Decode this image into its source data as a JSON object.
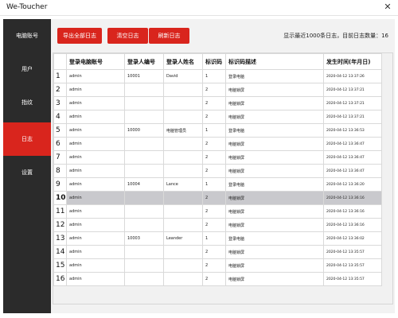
{
  "app": {
    "title": "We-Toucher",
    "close_symbol": "✕"
  },
  "sidebar": {
    "items": [
      {
        "label": "电脑账号",
        "active": false
      },
      {
        "label": "用户",
        "active": false
      },
      {
        "label": "指纹",
        "active": false
      },
      {
        "label": "日志",
        "active": true
      },
      {
        "label": "设置",
        "active": false
      }
    ]
  },
  "toolbar": {
    "export_label": "导出全部日志",
    "clear_label": "清空日志",
    "refresh_label": "刷新日志",
    "status_text": "显示最近1000条日志，目前日志数量：16"
  },
  "colors": {
    "accent": "#d9251d",
    "sidebar_bg": "#2b2b2b",
    "selected_row": "#c9c9cd"
  },
  "table": {
    "columns": [
      "登录电脑账号",
      "登录人编号",
      "登录人姓名",
      "标识码",
      "标识码描述",
      "发生时间(年月日)"
    ],
    "selected_row": 10,
    "rows": [
      {
        "index": "1",
        "account": "admin",
        "user_id": "10001",
        "user_name": "David",
        "code": "1",
        "desc": "登录电脑",
        "time": "2020-04-12 13:37:26"
      },
      {
        "index": "2",
        "account": "admin",
        "user_id": "",
        "user_name": "",
        "code": "2",
        "desc": "电脑锁屏",
        "time": "2020-04-12 13:37:21"
      },
      {
        "index": "3",
        "account": "admin",
        "user_id": "",
        "user_name": "",
        "code": "2",
        "desc": "电脑锁屏",
        "time": "2020-04-12 13:37:21"
      },
      {
        "index": "4",
        "account": "admin",
        "user_id": "",
        "user_name": "",
        "code": "2",
        "desc": "电脑锁屏",
        "time": "2020-04-12 13:37:21"
      },
      {
        "index": "5",
        "account": "admin",
        "user_id": "10000",
        "user_name": "电脑管理员",
        "code": "1",
        "desc": "登录电脑",
        "time": "2020-04-12 13:36:53"
      },
      {
        "index": "6",
        "account": "admin",
        "user_id": "",
        "user_name": "",
        "code": "2",
        "desc": "电脑锁屏",
        "time": "2020-04-12 13:36:47"
      },
      {
        "index": "7",
        "account": "admin",
        "user_id": "",
        "user_name": "",
        "code": "2",
        "desc": "电脑锁屏",
        "time": "2020-04-12 13:36:47"
      },
      {
        "index": "8",
        "account": "admin",
        "user_id": "",
        "user_name": "",
        "code": "2",
        "desc": "电脑锁屏",
        "time": "2020-04-12 13:36:47"
      },
      {
        "index": "9",
        "account": "admin",
        "user_id": "10004",
        "user_name": "Lance",
        "code": "1",
        "desc": "登录电脑",
        "time": "2020-04-12 13:36:20"
      },
      {
        "index": "10",
        "account": "admin",
        "user_id": "",
        "user_name": "",
        "code": "2",
        "desc": "电脑锁屏",
        "time": "2020-04-12 13:36:16"
      },
      {
        "index": "11",
        "account": "admin",
        "user_id": "",
        "user_name": "",
        "code": "2",
        "desc": "电脑锁屏",
        "time": "2020-04-12 13:36:16"
      },
      {
        "index": "12",
        "account": "admin",
        "user_id": "",
        "user_name": "",
        "code": "2",
        "desc": "电脑锁屏",
        "time": "2020-04-12 13:36:16"
      },
      {
        "index": "13",
        "account": "admin",
        "user_id": "10003",
        "user_name": "Leander",
        "code": "1",
        "desc": "登录电脑",
        "time": "2020-04-12 13:36:02"
      },
      {
        "index": "14",
        "account": "admin",
        "user_id": "",
        "user_name": "",
        "code": "2",
        "desc": "电脑锁屏",
        "time": "2020-04-12 13:35:57"
      },
      {
        "index": "15",
        "account": "admin",
        "user_id": "",
        "user_name": "",
        "code": "2",
        "desc": "电脑锁屏",
        "time": "2020-04-12 13:35:57"
      },
      {
        "index": "16",
        "account": "admin",
        "user_id": "",
        "user_name": "",
        "code": "2",
        "desc": "电脑锁屏",
        "time": "2020-04-12 13:35:57"
      }
    ]
  }
}
